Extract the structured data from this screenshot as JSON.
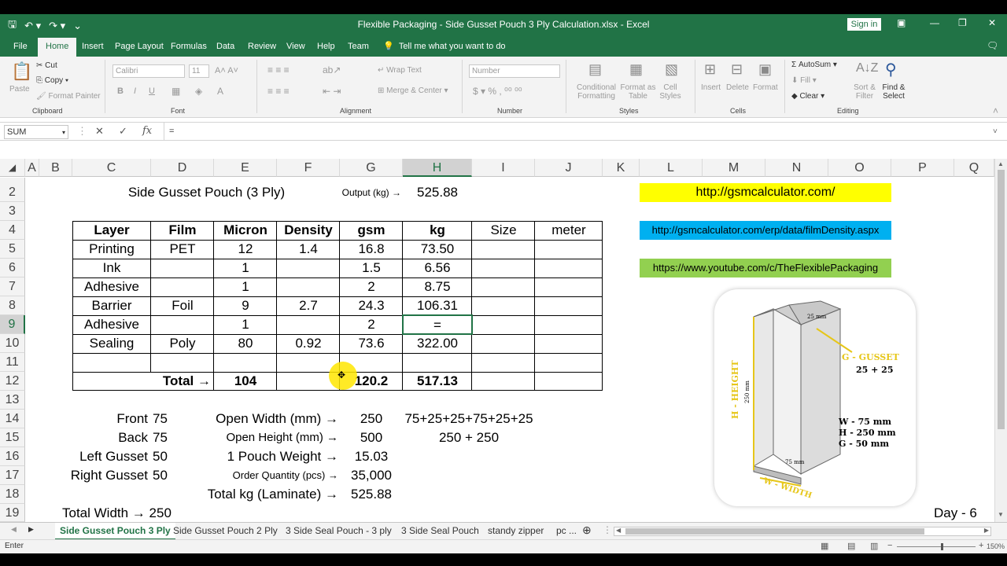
{
  "window": {
    "title": "Flexible Packaging - Side Gusset Pouch 3 Ply Calculation.xlsx  -  Excel",
    "signin": "Sign in"
  },
  "menu": {
    "tabs": [
      "File",
      "Home",
      "Insert",
      "Page Layout",
      "Formulas",
      "Data",
      "Review",
      "View",
      "Help",
      "Team"
    ],
    "tellme": "Tell me what you want to do"
  },
  "ribbon": {
    "clipboard": {
      "paste": "Paste",
      "cut": "Cut",
      "copy": "Copy",
      "format_painter": "Format Painter",
      "label": "Clipboard"
    },
    "font": {
      "name": "Calibri",
      "size": "11",
      "label": "Font"
    },
    "alignment": {
      "wrap": "Wrap Text",
      "merge": "Merge & Center",
      "label": "Alignment"
    },
    "number": {
      "format": "Number",
      "label": "Number"
    },
    "styles": {
      "conditional": "Conditional Formatting",
      "format_table": "Format as Table",
      "cell_styles": "Cell Styles",
      "label": "Styles"
    },
    "cells": {
      "insert": "Insert",
      "delete": "Delete",
      "format": "Format",
      "label": "Cells"
    },
    "editing": {
      "autosum": "AutoSum",
      "fill": "Fill",
      "clear": "Clear",
      "sort": "Sort & Filter",
      "find": "Find & Select",
      "label": "Editing"
    }
  },
  "formula_bar": {
    "name_box": "SUM",
    "formula": "="
  },
  "columns": [
    "A",
    "B",
    "C",
    "D",
    "E",
    "F",
    "G",
    "H",
    "I",
    "J",
    "K",
    "L",
    "M",
    "N",
    "O",
    "P",
    "Q"
  ],
  "rows": [
    "2",
    "3",
    "4",
    "5",
    "6",
    "7",
    "8",
    "9",
    "10",
    "11",
    "12",
    "13",
    "14",
    "15",
    "16",
    "17",
    "18",
    "19"
  ],
  "sheet": {
    "title": "Side Gusset Pouch (3 Ply)",
    "output_label": "Output (kg) →",
    "output_value": "525.88",
    "headers": [
      "Layer",
      "Film",
      "Micron",
      "Density",
      "gsm",
      "kg",
      "Size",
      "meter"
    ],
    "table_rows": [
      [
        "Printing",
        "PET",
        "12",
        "1.4",
        "16.8",
        "73.50"
      ],
      [
        "Ink",
        "",
        "1",
        "",
        "1.5",
        "6.56"
      ],
      [
        "Adhesive",
        "",
        "1",
        "",
        "2",
        "8.75"
      ],
      [
        "Barrier",
        "Foil",
        "9",
        "2.7",
        "24.3",
        "106.31"
      ],
      [
        "Adhesive",
        "",
        "1",
        "",
        "2",
        "="
      ],
      [
        "Sealing",
        "Poly",
        "80",
        "0.92",
        "73.6",
        "322.00"
      ],
      [
        "",
        "",
        "",
        "",
        "",
        ""
      ]
    ],
    "total": {
      "label": "Total →",
      "micron": "104",
      "gsm": "120.2",
      "kg": "517.13"
    },
    "dims": [
      {
        "label": "Front",
        "value": "75"
      },
      {
        "label": "Back",
        "value": "75"
      },
      {
        "label": "Left Gusset",
        "value": "50"
      },
      {
        "label": "Right Gusset",
        "value": "50"
      }
    ],
    "total_width": "Total Width →  250",
    "calc": [
      {
        "label": "Open Width (mm) →",
        "value": "250",
        "note": "75+25+25+75+25+25"
      },
      {
        "label": "Open Height (mm) →",
        "value": "500",
        "note": "250 + 250"
      },
      {
        "label": "1 Pouch Weight →",
        "value": "15.03",
        "note": ""
      },
      {
        "label": "Order Quantity (pcs) →",
        "value": "35,000",
        "note": ""
      },
      {
        "label": "Total kg (Laminate) →",
        "value": "525.88",
        "note": ""
      }
    ],
    "links": [
      {
        "text": "http://gsmcalculator.com/",
        "color": "#ffff00"
      },
      {
        "text": "http://gsmcalculator.com/erp/data/filmDensity.aspx",
        "color": "#00b0f0"
      },
      {
        "text": "https://www.youtube.com/c/TheFlexiblePackaging",
        "color": "#92d050"
      }
    ],
    "day": "Day - 6"
  },
  "diagram": {
    "height_label": "H - HEIGHT",
    "height_dim": "250 mm",
    "gusset_label": "G - GUSSET",
    "gusset_value": "25 + 25",
    "gusset_dim": "25 mm",
    "width_label": "W - WIDTH",
    "width_dim": "75 mm",
    "spec_w": "W - 75 mm",
    "spec_h": "H - 250 mm",
    "spec_g": "G - 50 mm"
  },
  "sheet_tabs": [
    "Side Gusset Pouch 3 Ply",
    "Side Gusset Pouch 2 Ply",
    "3 Side Seal Pouch - 3 ply",
    "3 Side Seal Pouch",
    "standy zipper",
    "pc ..."
  ],
  "status": {
    "mode": "Enter",
    "zoom": "150%"
  },
  "colors": {
    "accent": "#217346"
  }
}
